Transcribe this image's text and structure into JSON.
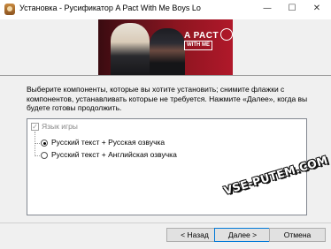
{
  "window": {
    "title": "Установка - Русификатор A Pact With Me Boys Lo",
    "minimize_glyph": "—",
    "maximize_glyph": "☐",
    "close_glyph": "✕"
  },
  "banner": {
    "logo_line1": "A PACT",
    "logo_line2": "WITH ME"
  },
  "description": "Выберите компоненты, которые вы хотите установить; снимите флажки с компонентов, устанавливать которые не требуется. Нажмите «Далее», когда вы будете готовы продолжить.",
  "components": {
    "root_label": "Язык игры",
    "root_checked": true,
    "options": [
      {
        "label": "Русский текст + Русская озвучка",
        "selected": true
      },
      {
        "label": "Русский текст + Английская озвучка",
        "selected": false
      }
    ]
  },
  "watermark": "VSE-PUTEM.COM",
  "buttons": {
    "back": "< Назад",
    "next": "Далее >",
    "cancel": "Отмена"
  },
  "colors": {
    "banner_bg": "#8e1520",
    "default_button_border": "#0078d7"
  }
}
